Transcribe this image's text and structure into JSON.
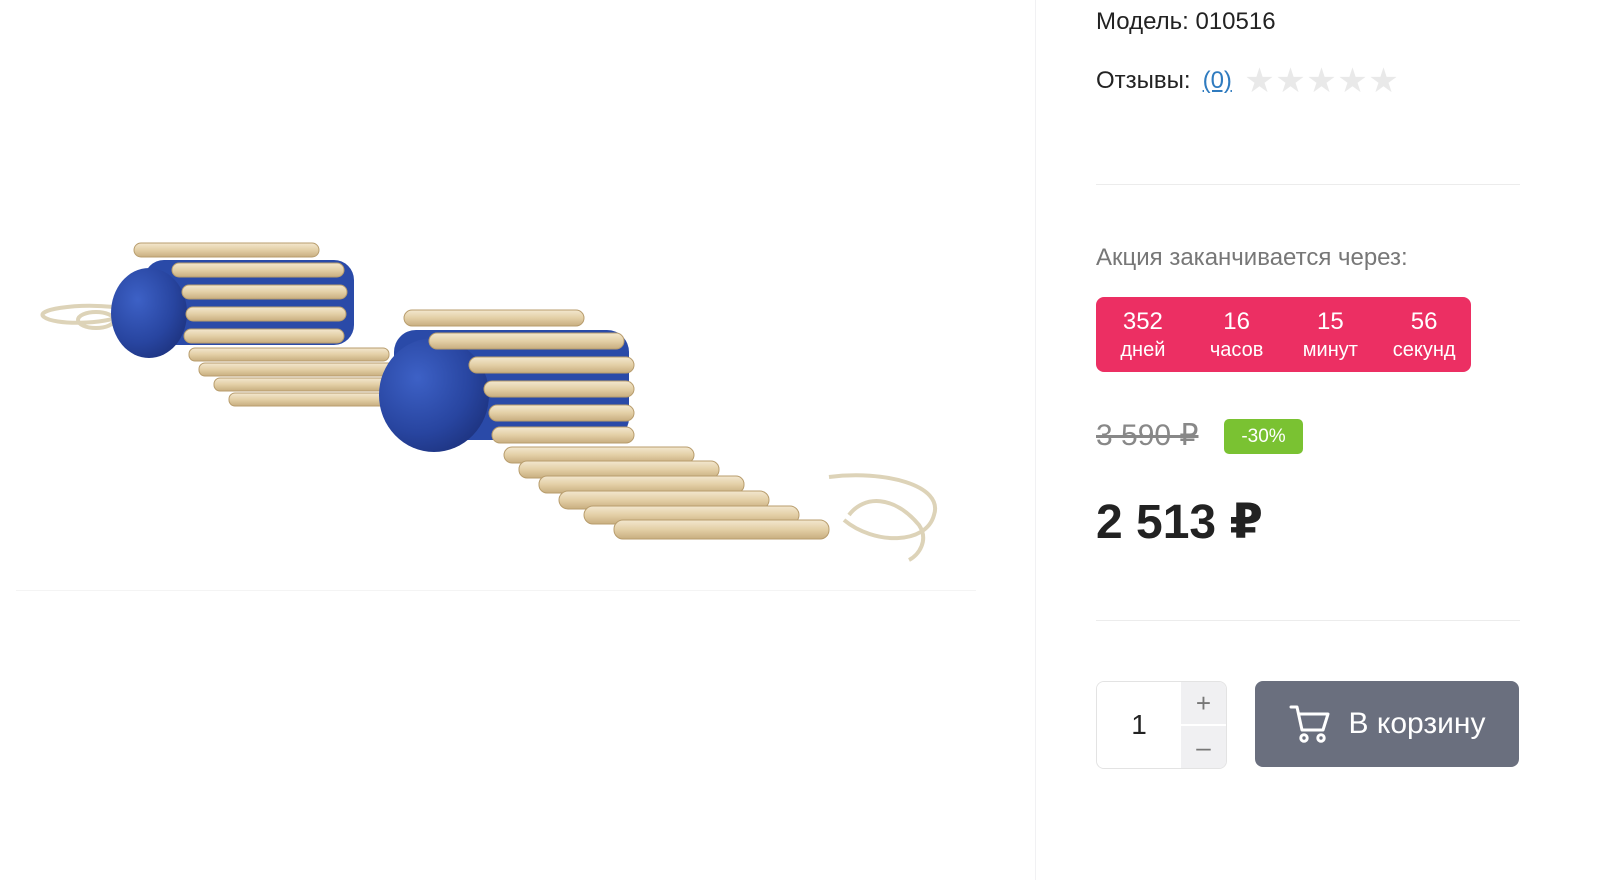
{
  "product": {
    "model_label": "Модель:",
    "model_value": "010516",
    "reviews_label": "Отзывы:",
    "reviews_count": "(0)",
    "rating_stars": 0,
    "image_alt": "Дорожка массажная с валиками"
  },
  "promo": {
    "label": "Акция заканчивается через:",
    "countdown": [
      {
        "value": "352",
        "unit": "дней"
      },
      {
        "value": "16",
        "unit": "часов"
      },
      {
        "value": "15",
        "unit": "минут"
      },
      {
        "value": "56",
        "unit": "секунд"
      }
    ]
  },
  "pricing": {
    "old_price": "3 590 ₽",
    "discount": "-30%",
    "new_price": "2 513 ₽"
  },
  "cart": {
    "quantity": "1",
    "plus": "+",
    "minus": "–",
    "button_label": "В корзину",
    "icon": "cart-icon"
  },
  "colors": {
    "countdown_bg": "#ec2f63",
    "discount_bg": "#7ac232",
    "cart_button_bg": "#6a6f7e",
    "link": "#2f7bbf"
  }
}
